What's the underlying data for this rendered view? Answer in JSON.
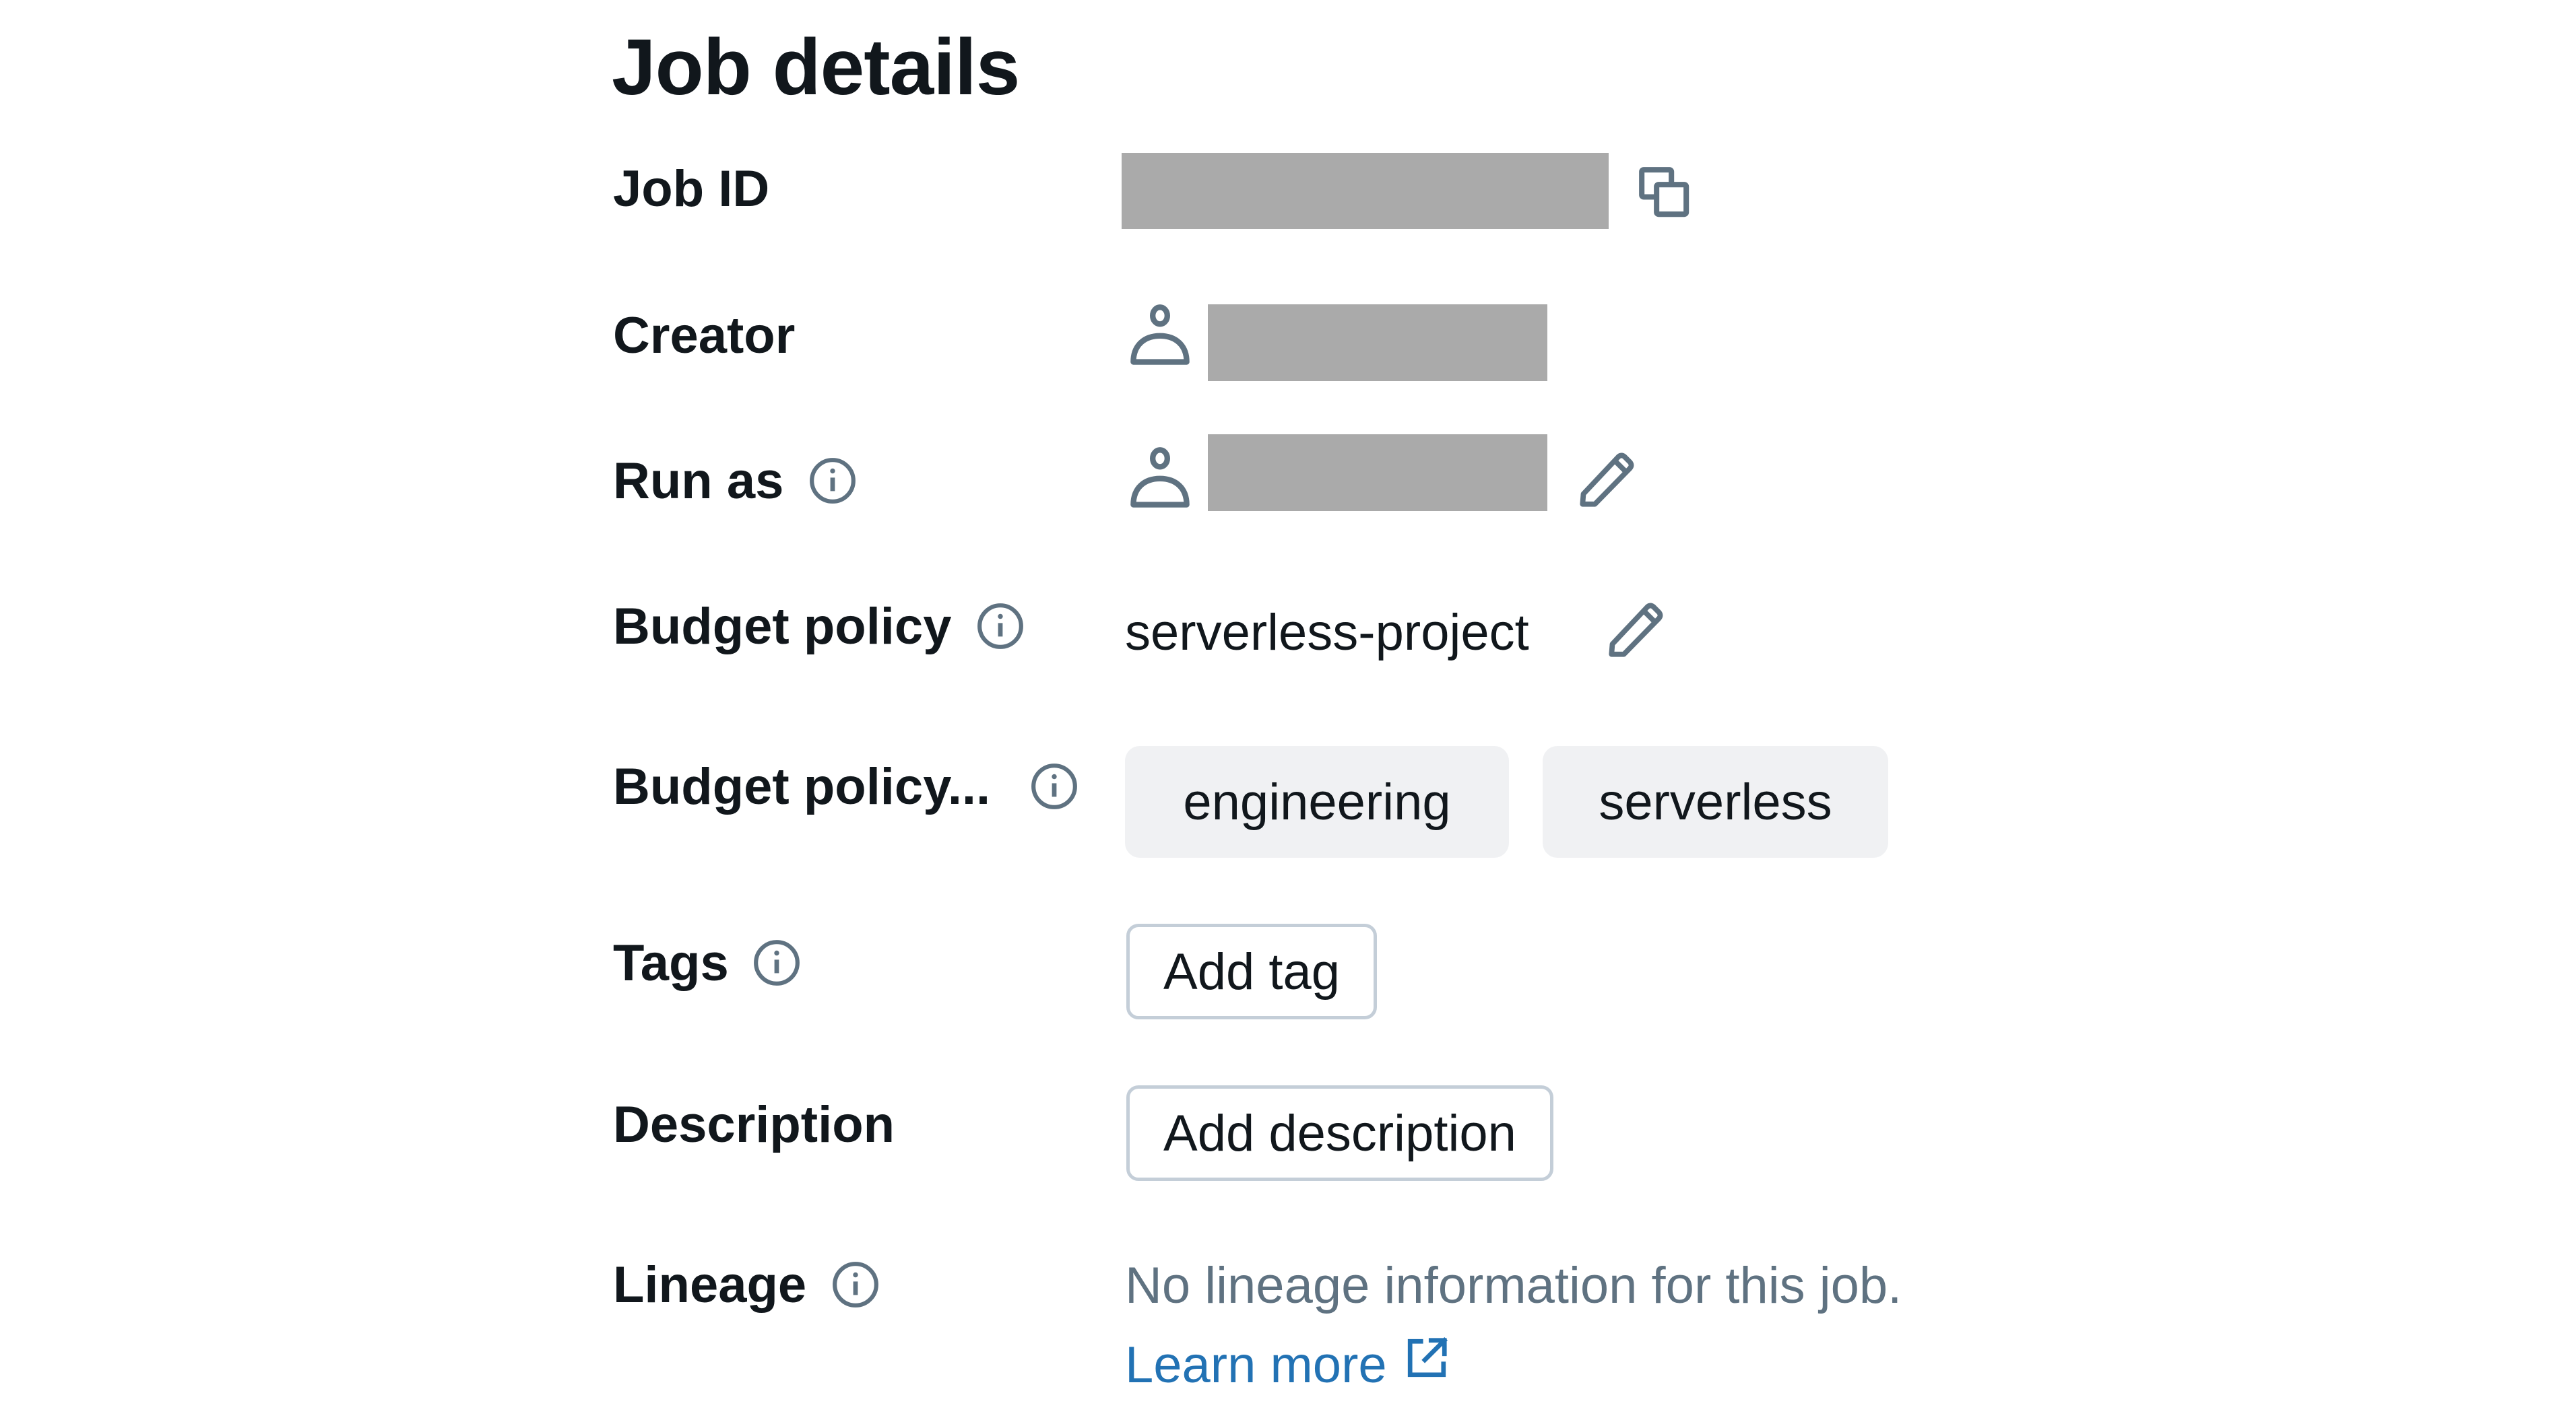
{
  "section": {
    "title": "Job details"
  },
  "rows": {
    "job_id": {
      "label": "Job ID",
      "value_redacted": true,
      "copy_icon": "copy-icon"
    },
    "creator": {
      "label": "Creator",
      "value_redacted": true,
      "icon": "user-icon"
    },
    "run_as": {
      "label": "Run as",
      "info_icon": "info-icon",
      "value_redacted": true,
      "icon": "user-icon",
      "edit_icon": "pencil-icon"
    },
    "budget_policy": {
      "label": "Budget policy",
      "info_icon": "info-icon",
      "value": "serverless-project",
      "edit_icon": "pencil-icon"
    },
    "budget_policy_tags": {
      "label": "Budget policy...",
      "info_icon": "info-icon",
      "chips": [
        "engineering",
        "serverless"
      ]
    },
    "tags": {
      "label": "Tags",
      "info_icon": "info-icon",
      "button": "Add tag"
    },
    "description": {
      "label": "Description",
      "button": "Add description"
    },
    "lineage": {
      "label": "Lineage",
      "info_icon": "info-icon",
      "message": "No lineage information for this job.",
      "link": "Learn more",
      "link_icon": "external-link-icon"
    }
  },
  "colors": {
    "text": "#11171c",
    "icon": "#5f7281",
    "redaction": "#aaaaaa",
    "chip_bg": "#f0f1f3",
    "button_border": "#c4ced8",
    "link": "#2272b4",
    "muted_text": "#5f7281"
  }
}
